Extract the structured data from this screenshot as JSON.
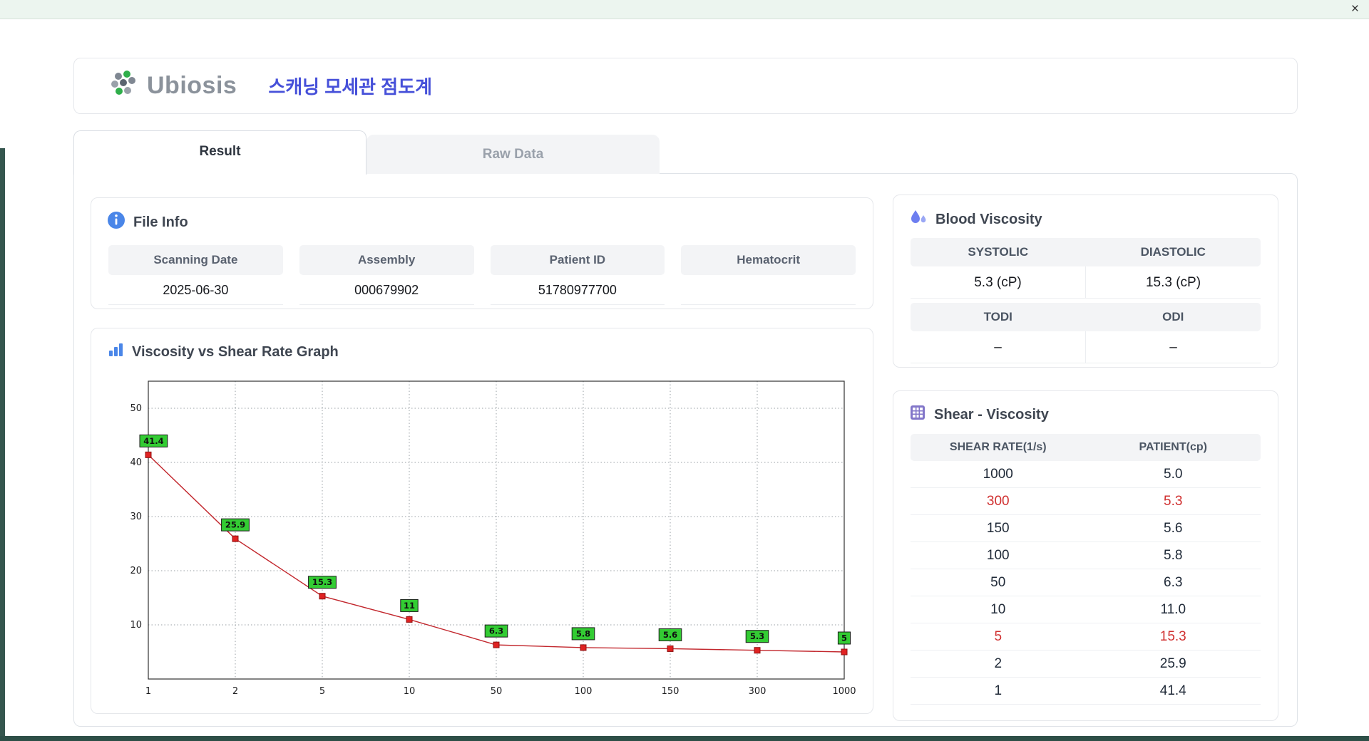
{
  "window": {
    "close_icon": "×"
  },
  "header": {
    "logo_text": "Ubiosis",
    "title": "스캐닝 모세관 점도계"
  },
  "tabs": [
    {
      "label": "Result",
      "active": true
    },
    {
      "label": "Raw Data",
      "active": false
    }
  ],
  "file_info": {
    "title": "File Info",
    "fields": [
      {
        "label": "Scanning Date",
        "value": "2025-06-30"
      },
      {
        "label": "Assembly",
        "value": "000679902"
      },
      {
        "label": "Patient ID",
        "value": "51780977700"
      },
      {
        "label": "Hematocrit",
        "value": ""
      }
    ]
  },
  "blood_viscosity": {
    "title": "Blood Viscosity",
    "rows": [
      {
        "cols": [
          {
            "label": "SYSTOLIC",
            "value": "5.3 (cP)"
          },
          {
            "label": "DIASTOLIC",
            "value": "15.3 (cP)"
          }
        ]
      },
      {
        "cols": [
          {
            "label": "TODI",
            "value": "–"
          },
          {
            "label": "ODI",
            "value": "–"
          }
        ]
      }
    ]
  },
  "graph": {
    "title": "Viscosity vs Shear Rate Graph"
  },
  "chart_data": {
    "type": "line",
    "title": "Viscosity vs Shear Rate Graph",
    "xlabel": "",
    "ylabel": "",
    "x_scale": "categorical (log-style ticks, evenly spaced)",
    "x_ticks": [
      1,
      2,
      5,
      10,
      50,
      100,
      150,
      300,
      1000
    ],
    "x": [
      1,
      2,
      5,
      10,
      50,
      100,
      150,
      300,
      1000
    ],
    "values": [
      41.4,
      25.9,
      15.3,
      11,
      6.3,
      5.8,
      5.6,
      5.3,
      5
    ],
    "point_labels": [
      "41.4",
      "25.9",
      "15.3",
      "11",
      "6.3",
      "5.8",
      "5.6",
      "5.3",
      "5"
    ],
    "y_ticks": [
      10,
      20,
      30,
      40,
      50
    ],
    "ylim": [
      0,
      55
    ],
    "grid": true,
    "line_color": "#c2272d",
    "marker_color": "#e02222",
    "marker_edge": "#8f1212",
    "label_bg": "#33cc33",
    "label_border": "#1a1a1a"
  },
  "shear_viscosity": {
    "title": "Shear - Viscosity",
    "columns": [
      "SHEAR RATE(1/s)",
      "PATIENT(cp)"
    ],
    "rows": [
      {
        "shear": "1000",
        "patient": "5.0",
        "highlight": false
      },
      {
        "shear": "300",
        "patient": "5.3",
        "highlight": true
      },
      {
        "shear": "150",
        "patient": "5.6",
        "highlight": false
      },
      {
        "shear": "100",
        "patient": "5.8",
        "highlight": false
      },
      {
        "shear": "50",
        "patient": "6.3",
        "highlight": false
      },
      {
        "shear": "10",
        "patient": "11.0",
        "highlight": false
      },
      {
        "shear": "5",
        "patient": "15.3",
        "highlight": true
      },
      {
        "shear": "2",
        "patient": "25.9",
        "highlight": false
      },
      {
        "shear": "1",
        "patient": "41.4",
        "highlight": false
      }
    ]
  }
}
